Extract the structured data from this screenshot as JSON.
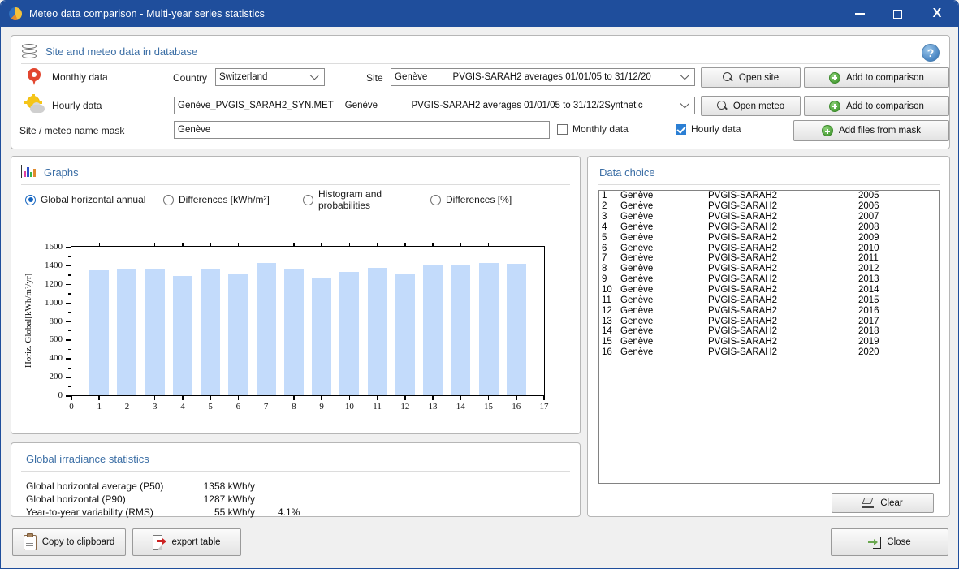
{
  "window": {
    "title": "Meteo data comparison - Multi-year series statistics",
    "icon": "pvsyst-pie-icon",
    "minimize": "—",
    "maximize": "☐",
    "close": "X"
  },
  "top_panel": {
    "title": "Site and meteo data in database",
    "icon": "database-icon",
    "help": "?",
    "monthly": {
      "label": "Monthly data",
      "icon": "map-pin-icon",
      "country_label": "Country",
      "country_value": "Switzerland",
      "site_label": "Site",
      "site_name": "Genève",
      "site_detail": "PVGIS-SARAH2 averages 01/01/05 to 31/12/20",
      "open_button": "Open site",
      "add_button": "Add to comparison"
    },
    "hourly": {
      "label": "Hourly data",
      "icon": "sun-cloud-icon",
      "file_name": "Genève_PVGIS_SARAH2_SYN.MET",
      "site_name": "Genève",
      "detail": "PVGIS-SARAH2 averages 01/01/05 to 31/12/2Synthetic",
      "open_button": "Open meteo",
      "add_button": "Add to comparison"
    },
    "mask": {
      "label": "Site / meteo name mask",
      "value": "Genève",
      "placeholder": "",
      "monthly_checkbox": "Monthly data",
      "monthly_checked": false,
      "hourly_checkbox": "Hourly data",
      "hourly_checked": true,
      "add_files_button": "Add files from mask"
    }
  },
  "graphs_panel": {
    "title": "Graphs",
    "icon": "bar-chart-icon",
    "options": [
      {
        "label": "Global horizontal annual",
        "selected": true
      },
      {
        "label": "Differences [kWh/m²]",
        "selected": false
      },
      {
        "label": "Histogram and probabilities",
        "selected": false
      },
      {
        "label": "Differences [%]",
        "selected": false
      }
    ]
  },
  "chart_data": {
    "type": "bar",
    "title": "",
    "xlabel": "",
    "ylabel": "Horiz. Global[kWh/m²/yr]",
    "categories": [
      "1",
      "2",
      "3",
      "4",
      "5",
      "6",
      "7",
      "8",
      "9",
      "10",
      "11",
      "12",
      "13",
      "14",
      "15",
      "16"
    ],
    "values": [
      1345,
      1355,
      1355,
      1285,
      1360,
      1300,
      1425,
      1355,
      1260,
      1330,
      1375,
      1305,
      1405,
      1395,
      1425,
      1415
    ],
    "xlim": [
      0,
      17
    ],
    "ylim": [
      0,
      1600
    ],
    "xticks": [
      "0",
      "1",
      "2",
      "3",
      "4",
      "5",
      "6",
      "7",
      "8",
      "9",
      "10",
      "11",
      "12",
      "13",
      "14",
      "15",
      "16",
      "17"
    ],
    "yticks": [
      "0",
      "200",
      "400",
      "600",
      "800",
      "1000",
      "1200",
      "1400",
      "1600"
    ],
    "bar_color": "#c3dbfb",
    "grid": false,
    "legend": "none"
  },
  "stats_panel": {
    "title": "Global irradiance statistics",
    "rows": [
      {
        "name": "Global horizontal average (P50)",
        "value": "1358 kWh/y",
        "pct": ""
      },
      {
        "name": "Global horizontal (P90)",
        "value": "1287 kWh/y",
        "pct": ""
      },
      {
        "name": "Year-to-year variability (RMS)",
        "value": "55 kWh/y",
        "pct": "4.1%"
      }
    ]
  },
  "data_choice": {
    "title": "Data choice",
    "clear_button": "Clear",
    "clear_icon": "eraser-icon",
    "rows": [
      {
        "idx": "1",
        "site": "Genève",
        "source": "PVGIS-SARAH2",
        "year": "2005"
      },
      {
        "idx": "2",
        "site": "Genève",
        "source": "PVGIS-SARAH2",
        "year": "2006"
      },
      {
        "idx": "3",
        "site": "Genève",
        "source": "PVGIS-SARAH2",
        "year": "2007"
      },
      {
        "idx": "4",
        "site": "Genève",
        "source": "PVGIS-SARAH2",
        "year": "2008"
      },
      {
        "idx": "5",
        "site": "Genève",
        "source": "PVGIS-SARAH2",
        "year": "2009"
      },
      {
        "idx": "6",
        "site": "Genève",
        "source": "PVGIS-SARAH2",
        "year": "2010"
      },
      {
        "idx": "7",
        "site": "Genève",
        "source": "PVGIS-SARAH2",
        "year": "2011"
      },
      {
        "idx": "8",
        "site": "Genève",
        "source": "PVGIS-SARAH2",
        "year": "2012"
      },
      {
        "idx": "9",
        "site": "Genève",
        "source": "PVGIS-SARAH2",
        "year": "2013"
      },
      {
        "idx": "10",
        "site": "Genève",
        "source": "PVGIS-SARAH2",
        "year": "2014"
      },
      {
        "idx": "11",
        "site": "Genève",
        "source": "PVGIS-SARAH2",
        "year": "2015"
      },
      {
        "idx": "12",
        "site": "Genève",
        "source": "PVGIS-SARAH2",
        "year": "2016"
      },
      {
        "idx": "13",
        "site": "Genève",
        "source": "PVGIS-SARAH2",
        "year": "2017"
      },
      {
        "idx": "14",
        "site": "Genève",
        "source": "PVGIS-SARAH2",
        "year": "2018"
      },
      {
        "idx": "15",
        "site": "Genève",
        "source": "PVGIS-SARAH2",
        "year": "2019"
      },
      {
        "idx": "16",
        "site": "Genève",
        "source": "PVGIS-SARAH2",
        "year": "2020"
      }
    ]
  },
  "footer": {
    "copy_button": "Copy to clipboard",
    "copy_icon": "clipboard-icon",
    "export_button": "export table",
    "export_icon": "export-document-icon",
    "close_button": "Close",
    "close_icon": "exit-door-icon"
  },
  "colors": {
    "titlebar": "#1f4e9c",
    "group_title": "#3b6ea5",
    "bar": "#c3dbfb",
    "accent_checkbox": "#2b7fd4"
  }
}
